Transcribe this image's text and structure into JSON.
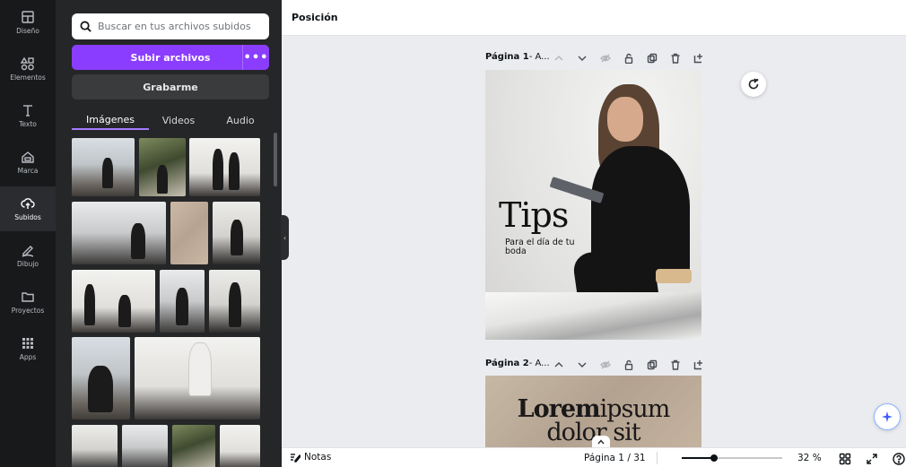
{
  "rail": {
    "items": [
      {
        "label": "Diseño",
        "icon": "layout-icon"
      },
      {
        "label": "Elementos",
        "icon": "shapes-icon"
      },
      {
        "label": "Texto",
        "icon": "text-icon"
      },
      {
        "label": "Marca",
        "icon": "brand-icon"
      },
      {
        "label": "Subidos",
        "icon": "cloud-upload-icon",
        "active": true
      },
      {
        "label": "Dibujo",
        "icon": "draw-icon"
      },
      {
        "label": "Proyectos",
        "icon": "folder-icon"
      },
      {
        "label": "Apps",
        "icon": "apps-grid-icon"
      }
    ]
  },
  "panel": {
    "search_placeholder": "Buscar en tus archivos subidos",
    "upload_label": "Subir archivos",
    "upload_more": "•••",
    "record_label": "Grabarme",
    "tabs": [
      "Imágenes",
      "Videos",
      "Audio"
    ],
    "active_tab": "Imágenes"
  },
  "header": {
    "title": "Posición"
  },
  "canvas": {
    "page1": {
      "label_bold": "Página 1",
      "label_rest": " - A...",
      "title": "Tips",
      "subtitle": "Para el día de tu boda"
    },
    "page2": {
      "label_bold": "Página 2",
      "label_rest": " - A...",
      "title_bold": "Lorem",
      "title_rest": "ipsum",
      "title_line2": "dolor sit"
    }
  },
  "bottombar": {
    "notes_label": "Notas",
    "page_info": "Página 1 / 31",
    "zoom_label": "32 %",
    "zoom_fraction": 0.32
  },
  "colors": {
    "accent": "#8b3dff",
    "rail_bg": "#18191b",
    "panel_bg": "#252627",
    "canvas_bg": "#ebecf0"
  }
}
